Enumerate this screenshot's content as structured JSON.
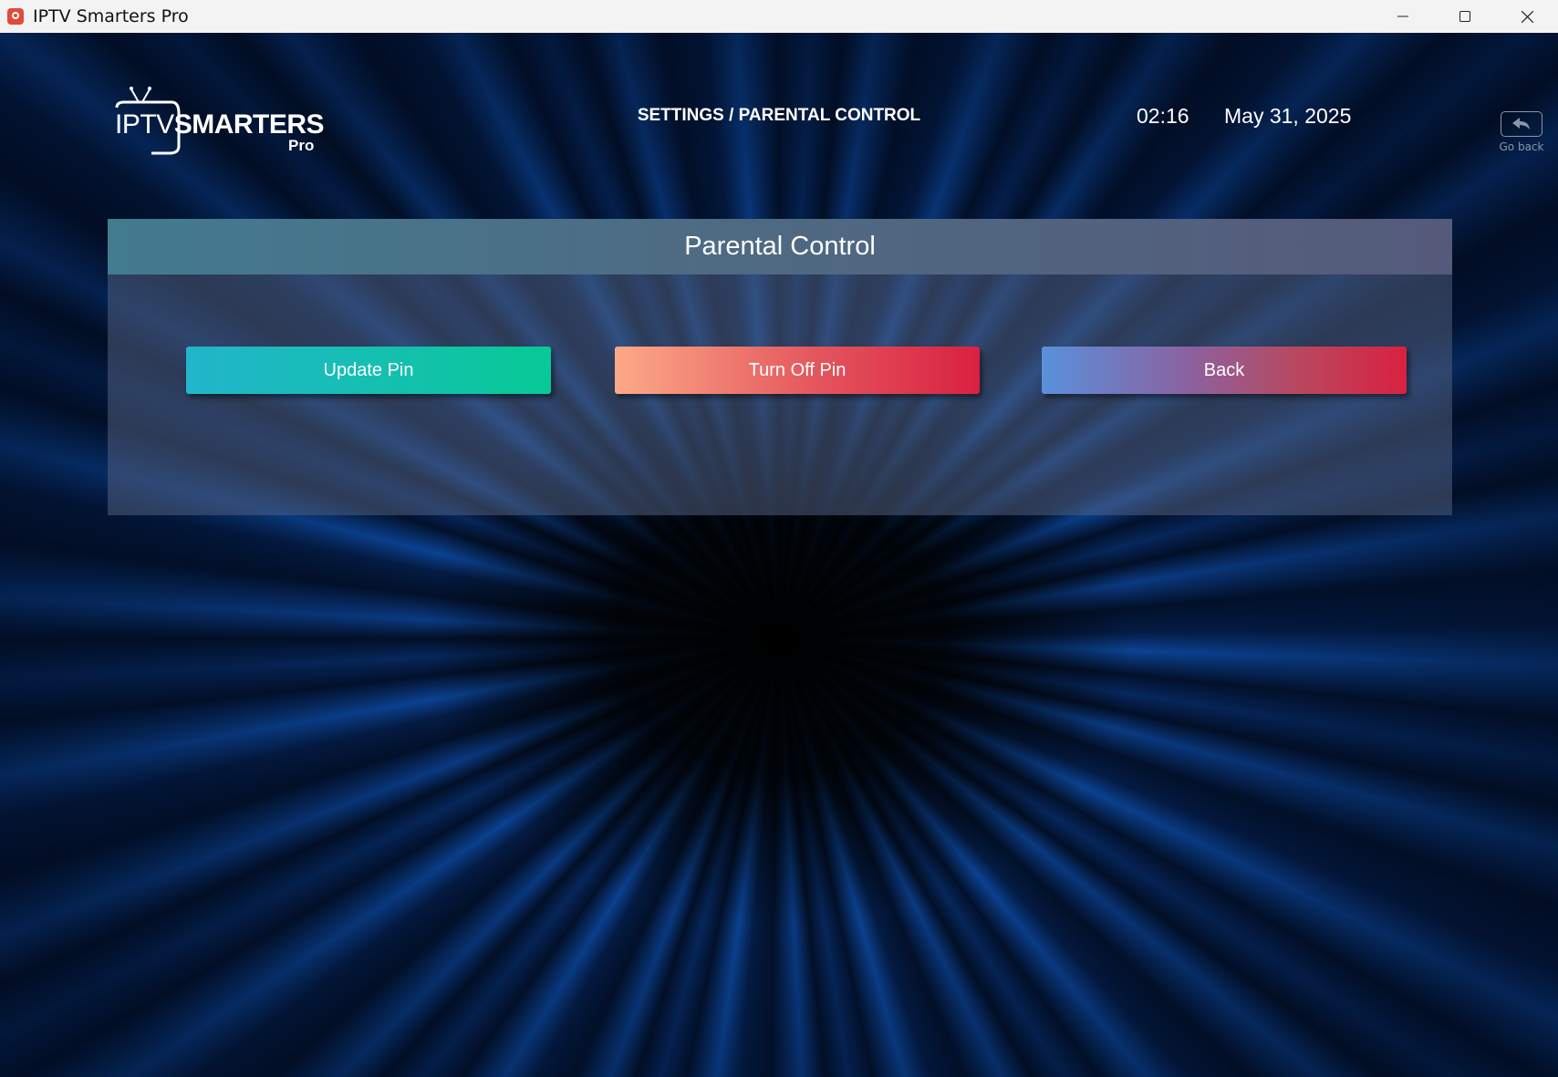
{
  "window": {
    "title": "IPTV Smarters Pro",
    "controls": {
      "minimize": "minimize-icon",
      "maximize": "maximize-icon",
      "close": "close-icon"
    }
  },
  "header": {
    "logo": {
      "iptv": "IPTV",
      "smarters": "SMARTERS",
      "pro": "Pro"
    },
    "breadcrumb": "SETTINGS / PARENTAL CONTROL",
    "time": "02:16",
    "date": "May 31, 2025",
    "go_back_label": "Go back"
  },
  "panel": {
    "title": "Parental Control",
    "buttons": {
      "update_pin": "Update Pin",
      "turn_off_pin": "Turn Off Pin",
      "back": "Back"
    }
  },
  "colors": {
    "update_pin": [
      "#22b5cc",
      "#08c996"
    ],
    "turn_off_pin": [
      "#fdaa88",
      "#d92140"
    ],
    "back": [
      "#5a90dc",
      "#d92140"
    ],
    "panel_header": [
      "#437b8f",
      "#555a7b"
    ]
  }
}
